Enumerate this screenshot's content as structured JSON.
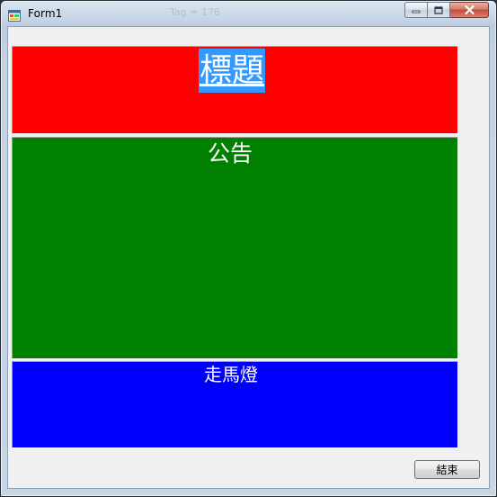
{
  "window": {
    "title": "Form1",
    "ghost_text": [
      "Tag = 176"
    ]
  },
  "panels": {
    "title": {
      "label": "標題",
      "bg": "#ff0000"
    },
    "notice": {
      "label": "公告",
      "bg": "#008000"
    },
    "marquee": {
      "label": "走馬燈",
      "bg": "#0000ff"
    }
  },
  "buttons": {
    "exit_label": "結束"
  },
  "colors": {
    "title_label_highlight": "#3399ff",
    "client_bg": "#f0f0f0"
  },
  "icons": {
    "app": "windows-form-icon",
    "minimize": "minimize-icon",
    "maximize": "maximize-icon",
    "close": "close-icon"
  }
}
